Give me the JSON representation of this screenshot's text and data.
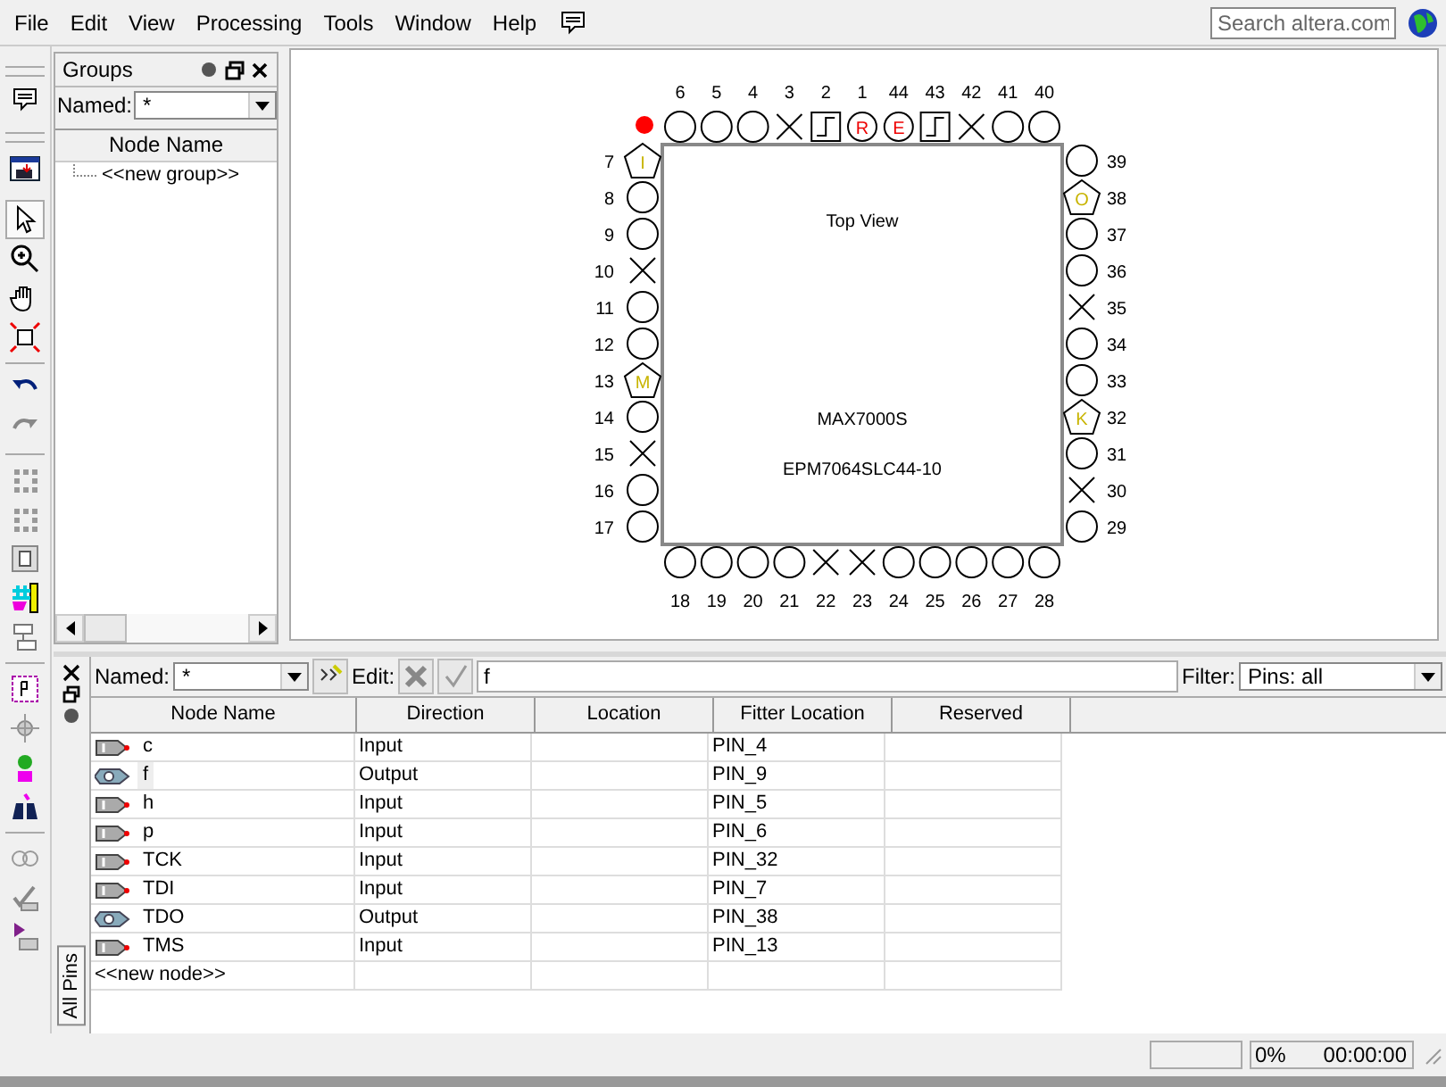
{
  "menu": [
    "File",
    "Edit",
    "View",
    "Processing",
    "Tools",
    "Window",
    "Help"
  ],
  "search": {
    "placeholder": "Search altera.com"
  },
  "groups_panel": {
    "title": "Groups",
    "named_label": "Named:",
    "named_value": "*",
    "column": "Node Name",
    "items": [
      "<<new group>>"
    ]
  },
  "pin_planner": {
    "view_label": "Top View",
    "family": "MAX7000S",
    "device": "EPM7064SLC44-10",
    "top": [
      {
        "number": "6",
        "kind": "unused"
      },
      {
        "number": "5",
        "kind": "unused"
      },
      {
        "number": "4",
        "kind": "unused"
      },
      {
        "number": "3",
        "kind": "no-connect"
      },
      {
        "number": "2",
        "kind": "clock"
      },
      {
        "number": "1",
        "kind": "lettered",
        "letter": "R"
      },
      {
        "number": "44",
        "kind": "lettered",
        "letter": "E"
      },
      {
        "number": "43",
        "kind": "clock"
      },
      {
        "number": "42",
        "kind": "no-connect"
      },
      {
        "number": "41",
        "kind": "unused"
      },
      {
        "number": "40",
        "kind": "unused"
      }
    ],
    "left": [
      {
        "number": "7",
        "kind": "assigned",
        "letter": "I"
      },
      {
        "number": "8",
        "kind": "unused"
      },
      {
        "number": "9",
        "kind": "unused"
      },
      {
        "number": "10",
        "kind": "no-connect"
      },
      {
        "number": "11",
        "kind": "unused"
      },
      {
        "number": "12",
        "kind": "unused"
      },
      {
        "number": "13",
        "kind": "assigned",
        "letter": "M"
      },
      {
        "number": "14",
        "kind": "unused"
      },
      {
        "number": "15",
        "kind": "no-connect"
      },
      {
        "number": "16",
        "kind": "unused"
      },
      {
        "number": "17",
        "kind": "unused"
      }
    ],
    "right": [
      {
        "number": "39",
        "kind": "unused"
      },
      {
        "number": "38",
        "kind": "assigned",
        "letter": "O"
      },
      {
        "number": "37",
        "kind": "unused"
      },
      {
        "number": "36",
        "kind": "unused"
      },
      {
        "number": "35",
        "kind": "no-connect"
      },
      {
        "number": "34",
        "kind": "unused"
      },
      {
        "number": "33",
        "kind": "unused"
      },
      {
        "number": "32",
        "kind": "assigned",
        "letter": "K"
      },
      {
        "number": "31",
        "kind": "unused"
      },
      {
        "number": "30",
        "kind": "no-connect"
      },
      {
        "number": "29",
        "kind": "unused"
      }
    ],
    "bottom": [
      {
        "number": "18",
        "kind": "unused"
      },
      {
        "number": "19",
        "kind": "unused"
      },
      {
        "number": "20",
        "kind": "unused"
      },
      {
        "number": "21",
        "kind": "unused"
      },
      {
        "number": "22",
        "kind": "no-connect"
      },
      {
        "number": "23",
        "kind": "no-connect"
      },
      {
        "number": "24",
        "kind": "unused"
      },
      {
        "number": "25",
        "kind": "unused"
      },
      {
        "number": "26",
        "kind": "unused"
      },
      {
        "number": "27",
        "kind": "unused"
      },
      {
        "number": "28",
        "kind": "unused"
      }
    ]
  },
  "pins_panel": {
    "tab": "All Pins",
    "named_label": "Named:",
    "named_value": "*",
    "edit_label": "Edit:",
    "edit_value": "f",
    "filter_label": "Filter:",
    "filter_value": "Pins: all",
    "columns": [
      "Node Name",
      "Direction",
      "Location",
      "Fitter Location",
      "Reserved"
    ],
    "rows": [
      {
        "node_name": "c",
        "kind": "input",
        "direction": "Input",
        "fitter_location": "PIN_4",
        "selected": false
      },
      {
        "node_name": "f",
        "kind": "output",
        "direction": "Output",
        "fitter_location": "PIN_9",
        "selected": true
      },
      {
        "node_name": "h",
        "kind": "input",
        "direction": "Input",
        "fitter_location": "PIN_5",
        "selected": false
      },
      {
        "node_name": "p",
        "kind": "input",
        "direction": "Input",
        "fitter_location": "PIN_6",
        "selected": false
      },
      {
        "node_name": "TCK",
        "kind": "input",
        "direction": "Input",
        "fitter_location": "PIN_32",
        "selected": false
      },
      {
        "node_name": "TDI",
        "kind": "input",
        "direction": "Input",
        "fitter_location": "PIN_7",
        "selected": false
      },
      {
        "node_name": "TDO",
        "kind": "output",
        "direction": "Output",
        "fitter_location": "PIN_38",
        "selected": false
      },
      {
        "node_name": "TMS",
        "kind": "input",
        "direction": "Input",
        "fitter_location": "PIN_13",
        "selected": false
      }
    ],
    "new_node": "<<new node>>"
  },
  "status_bar": {
    "progress": "0%",
    "elapsed": "00:00:00"
  }
}
